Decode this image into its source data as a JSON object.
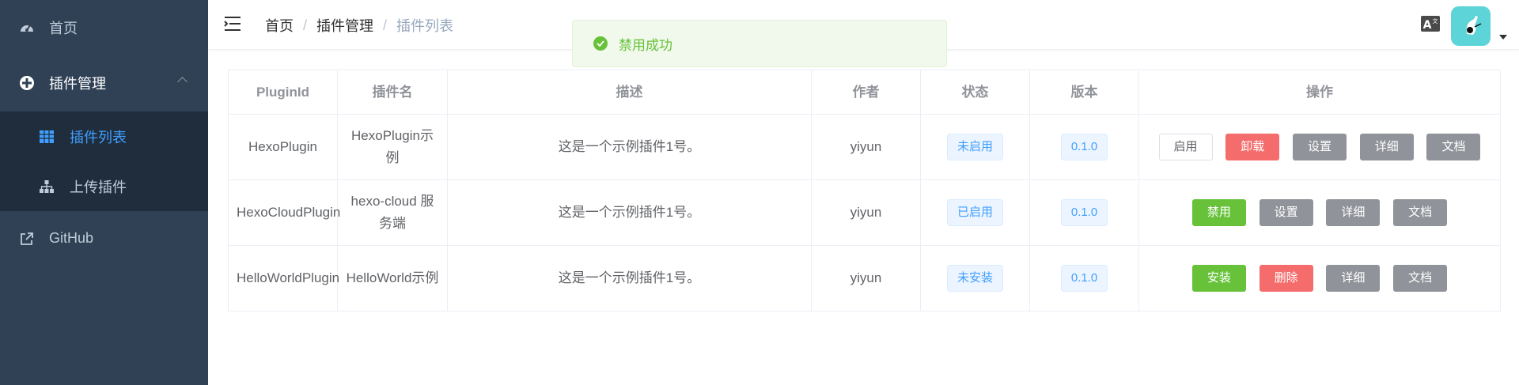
{
  "sidebar": {
    "home": "首页",
    "plugin_mgmt": "插件管理",
    "plugin_list": "插件列表",
    "upload_plugin": "上传插件",
    "github": "GitHub"
  },
  "breadcrumb": [
    "首页",
    "插件管理",
    "插件列表"
  ],
  "toast": {
    "message": "禁用成功",
    "type": "success"
  },
  "table": {
    "headers": [
      "PluginId",
      "插件名",
      "描述",
      "作者",
      "状态",
      "版本",
      "操作"
    ],
    "rows": [
      {
        "id": "HexoPlugin",
        "name": "HexoPlugin示例",
        "desc": "这是一个示例插件1号。",
        "author": "yiyun",
        "status": "未启用",
        "version": "0.1.0",
        "actions": [
          "启用",
          "卸载",
          "设置",
          "详细",
          "文档"
        ]
      },
      {
        "id": "HexoCloudPlugin",
        "name": "hexo-cloud 服务端",
        "desc": "这是一个示例插件1号。",
        "author": "yiyun",
        "status": "已启用",
        "version": "0.1.0",
        "actions": [
          "禁用",
          "设置",
          "详细",
          "文档"
        ]
      },
      {
        "id": "HelloWorldPlugin",
        "name": "HelloWorld示例",
        "desc": "这是一个示例插件1号。",
        "author": "yiyun",
        "status": "未安装",
        "version": "0.1.0",
        "actions": [
          "安装",
          "删除",
          "详细",
          "文档"
        ]
      }
    ]
  },
  "colors": {
    "sidebar_bg": "#304156",
    "submenu_bg": "#1f2d3d",
    "active": "#409eff",
    "success": "#67c23a",
    "danger": "#f56c6c",
    "info": "#909399"
  },
  "icons": {
    "home": "dashboard-icon",
    "plugin_mgmt": "plugin-icon",
    "plugin_list": "table-icon",
    "upload": "tree-icon",
    "github": "external-link-icon",
    "lang": "language-icon"
  }
}
